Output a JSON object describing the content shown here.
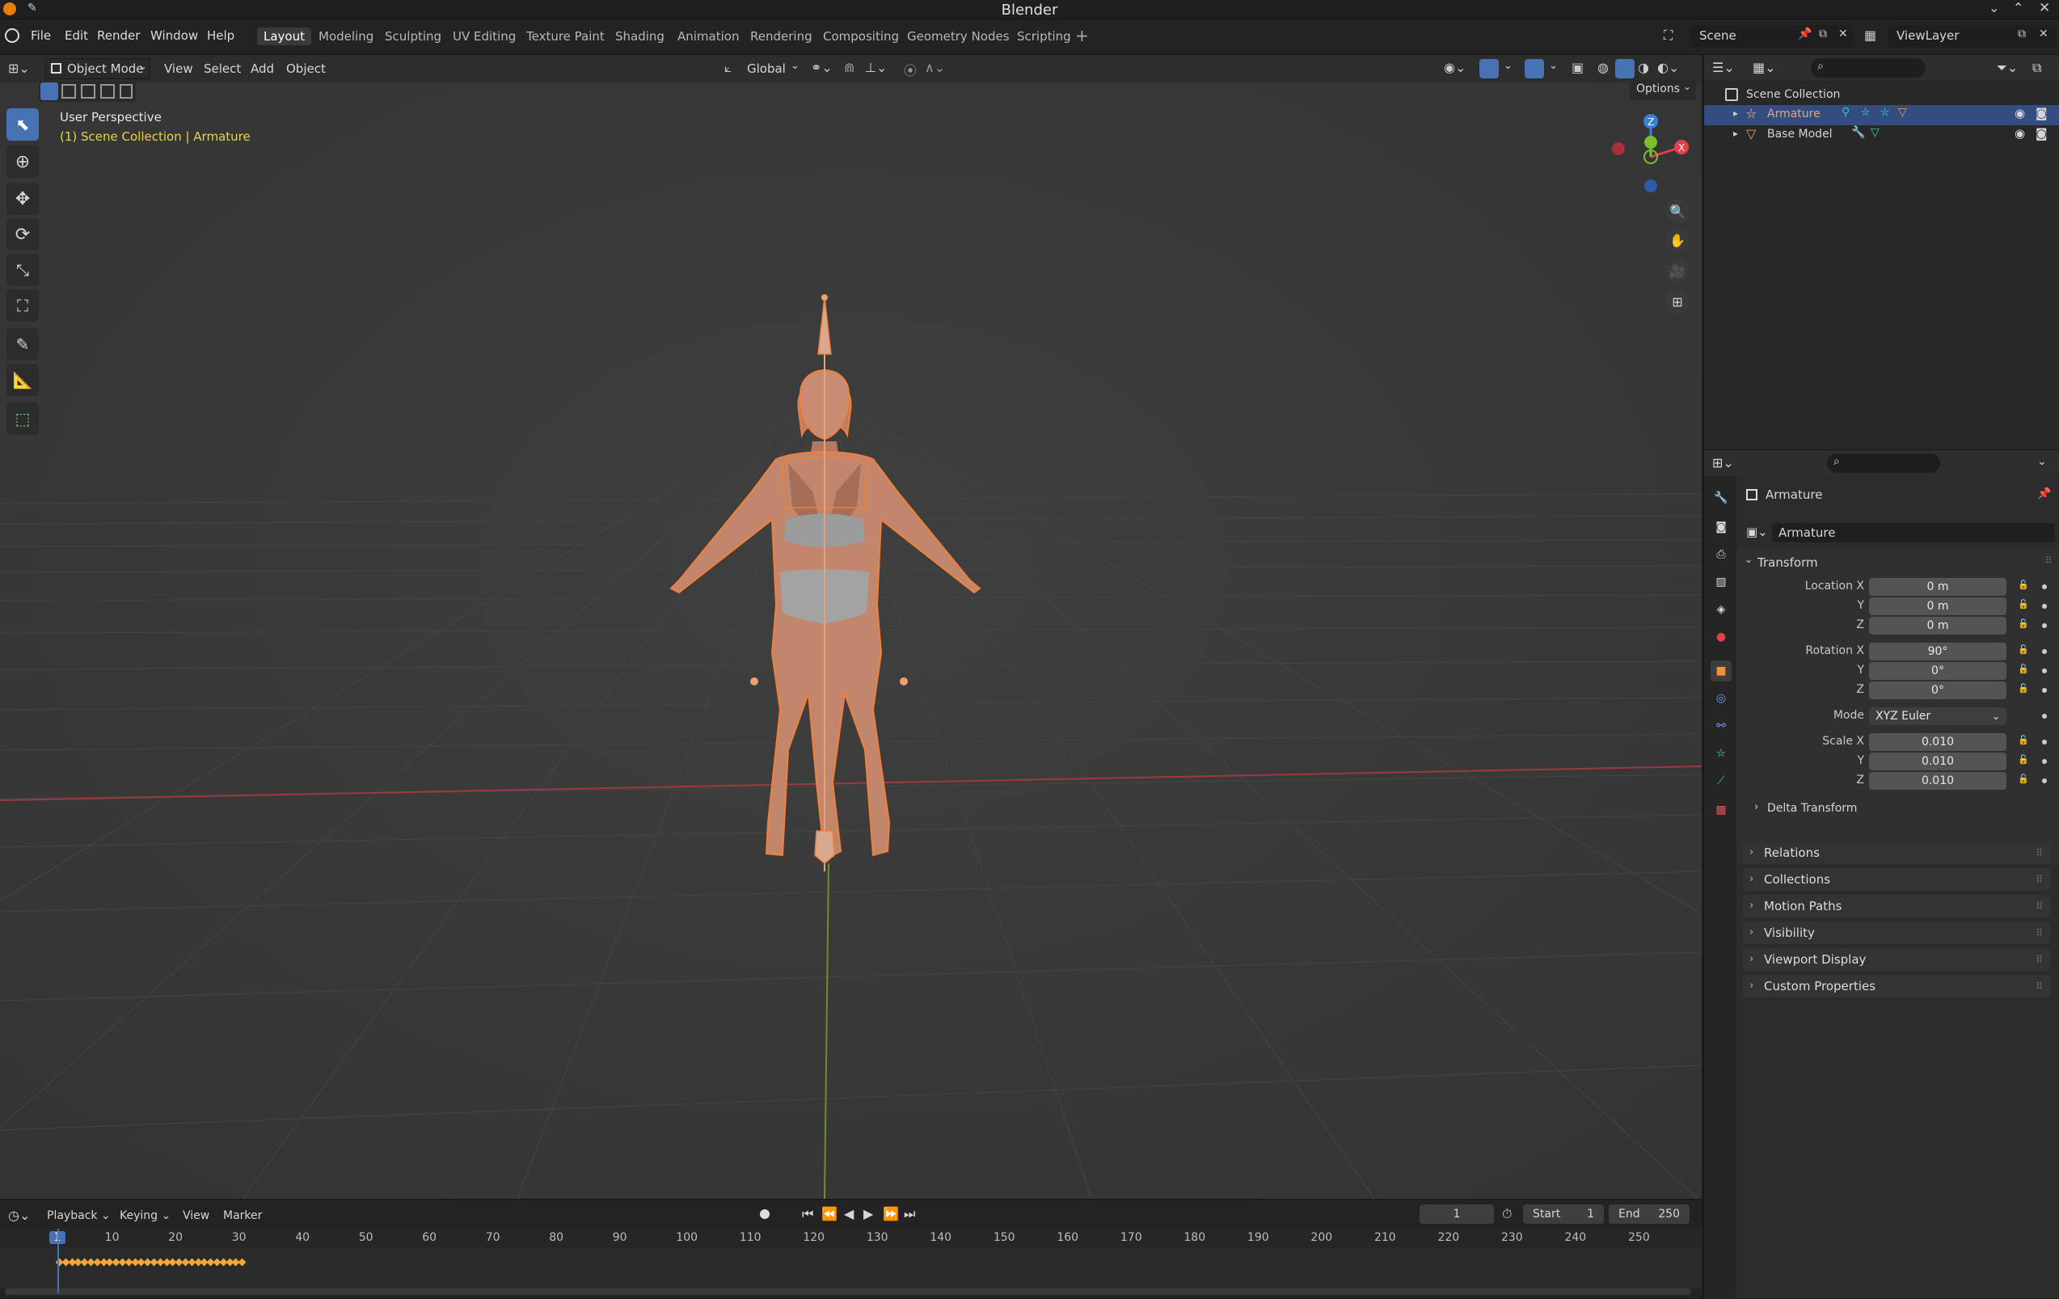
{
  "window": {
    "title": "Blender"
  },
  "menus": [
    "File",
    "Edit",
    "Render",
    "Window",
    "Help"
  ],
  "workspaces": [
    "Layout",
    "Modeling",
    "Sculpting",
    "UV Editing",
    "Texture Paint",
    "Shading",
    "Animation",
    "Rendering",
    "Compositing",
    "Geometry Nodes",
    "Scripting"
  ],
  "active_workspace": "Layout",
  "scene": {
    "name": "Scene",
    "view_layer": "ViewLayer"
  },
  "viewport": {
    "mode": "Object Mode",
    "menus": [
      "View",
      "Select",
      "Add",
      "Object"
    ],
    "orientation": "Global",
    "options_label": "Options",
    "perspective_label": "User Perspective",
    "context_label": "(1) Scene Collection | Armature",
    "gizmo_axes": {
      "x": "X",
      "y": "Y",
      "z": "Z"
    }
  },
  "timeline": {
    "menus": [
      "Playback",
      "Keying",
      "View",
      "Marker"
    ],
    "current_frame": "1",
    "start_label": "Start",
    "start_value": "1",
    "end_label": "End",
    "end_value": "250",
    "ticks": [
      "1",
      "10",
      "20",
      "30",
      "40",
      "50",
      "60",
      "70",
      "80",
      "90",
      "100",
      "110",
      "120",
      "130",
      "140",
      "150",
      "160",
      "170",
      "180",
      "190",
      "200",
      "210",
      "220",
      "230",
      "240",
      "250"
    ]
  },
  "outliner": {
    "root": "Scene Collection",
    "items": [
      {
        "name": "Armature",
        "selected": true
      },
      {
        "name": "Base Model",
        "selected": false
      }
    ]
  },
  "properties": {
    "object_name": "Armature",
    "data_name": "Armature",
    "transform": {
      "title": "Transform",
      "location_label": "Location X",
      "location": [
        "0 m",
        "0 m",
        "0 m"
      ],
      "rotation_label": "Rotation X",
      "rotation": [
        "90°",
        "0°",
        "0°"
      ],
      "mode_label": "Mode",
      "mode_value": "XYZ Euler",
      "scale_label": "Scale X",
      "scale": [
        "0.010",
        "0.010",
        "0.010"
      ],
      "y_label": "Y",
      "z_label": "Z"
    },
    "delta_transform": "Delta Transform",
    "panels": [
      "Relations",
      "Collections",
      "Motion Paths",
      "Visibility",
      "Viewport Display",
      "Custom Properties"
    ]
  },
  "colors": {
    "accent": "#4772b3",
    "selection_orange": "#f0803a",
    "context_yellow": "#e8d44a",
    "axis_x": "#e2404a",
    "axis_y": "#7bbf2f",
    "axis_z": "#3b7ddd",
    "outliner_selected": "#334d80"
  }
}
